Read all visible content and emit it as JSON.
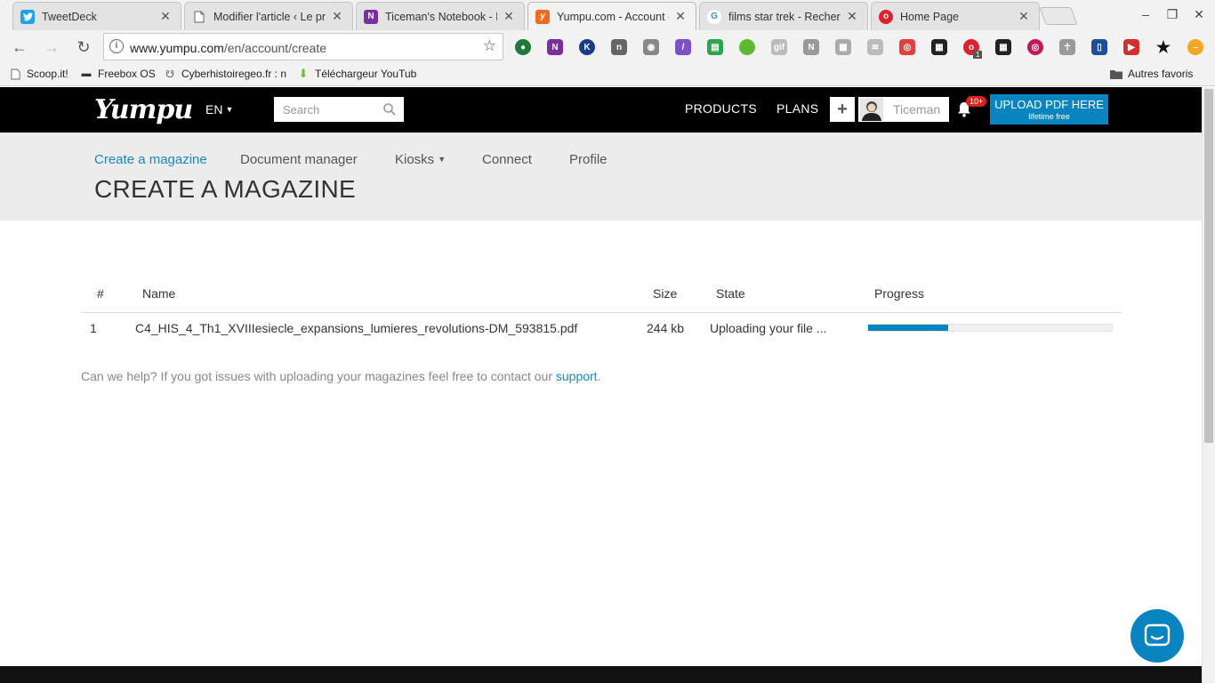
{
  "browser": {
    "tabs": [
      {
        "title": "TweetDeck",
        "favicon": "twitter-icon",
        "color": "#1da1f2",
        "glyph": "t"
      },
      {
        "title": "Modifier l'article ‹ Le prof",
        "favicon": "page-icon",
        "color": "#ffffff",
        "glyph": ""
      },
      {
        "title": "Ticeman's Notebook - M",
        "favicon": "onenote-icon",
        "color": "#7b2f9e",
        "glyph": "N"
      },
      {
        "title": "Yumpu.com - Account -",
        "favicon": "yumpu-icon",
        "color": "#f26b21",
        "glyph": "y"
      },
      {
        "title": "films star trek - Recherch",
        "favicon": "google-icon",
        "color": "#ffffff",
        "glyph": "G"
      },
      {
        "title": "Home Page",
        "favicon": "opera-icon",
        "color": "#e0202a",
        "glyph": "o"
      }
    ],
    "url": {
      "host": "www.yumpu.com",
      "path": "/en/account/create"
    },
    "extension_badge": "1",
    "bookmarks": [
      {
        "label": "Scoop.it!",
        "icon": "page-icon"
      },
      {
        "label": "Freebox OS",
        "icon": "freebox-icon"
      },
      {
        "label": "Cyberhistoiregeo.fr : n",
        "icon": "cat-icon"
      },
      {
        "label": "Téléchargeur YouTub",
        "icon": "download-icon"
      }
    ],
    "other_bookmarks": "Autres favoris"
  },
  "site": {
    "logo": "Yumpu",
    "lang": "EN",
    "search_placeholder": "Search",
    "nav": {
      "products": "PRODUCTS",
      "plans": "PLANS"
    },
    "plus": "+",
    "username": "Ticeman",
    "notifications": "10+",
    "upload": {
      "line1": "UPLOAD PDF HERE",
      "line2": "lifetime free"
    }
  },
  "subnav": {
    "create": "Create a magazine",
    "docs": "Document manager",
    "kiosks": "Kiosks",
    "connect": "Connect",
    "profile": "Profile"
  },
  "page_title": "CREATE A MAGAZINE",
  "table": {
    "headers": {
      "num": "#",
      "name": "Name",
      "size": "Size",
      "state": "State",
      "progress": "Progress"
    },
    "row": {
      "num": "1",
      "name": "C4_HIS_4_Th1_XVIIIesiecle_expansions_lumieres_revolutions-DM_593815.pdf",
      "size": "244 kb",
      "state": "Uploading your file ...",
      "progress": 0.33
    }
  },
  "help": {
    "text": "Can we help? If you got issues with uploading your magazines feel free to contact our ",
    "link": "support",
    "end": "."
  }
}
